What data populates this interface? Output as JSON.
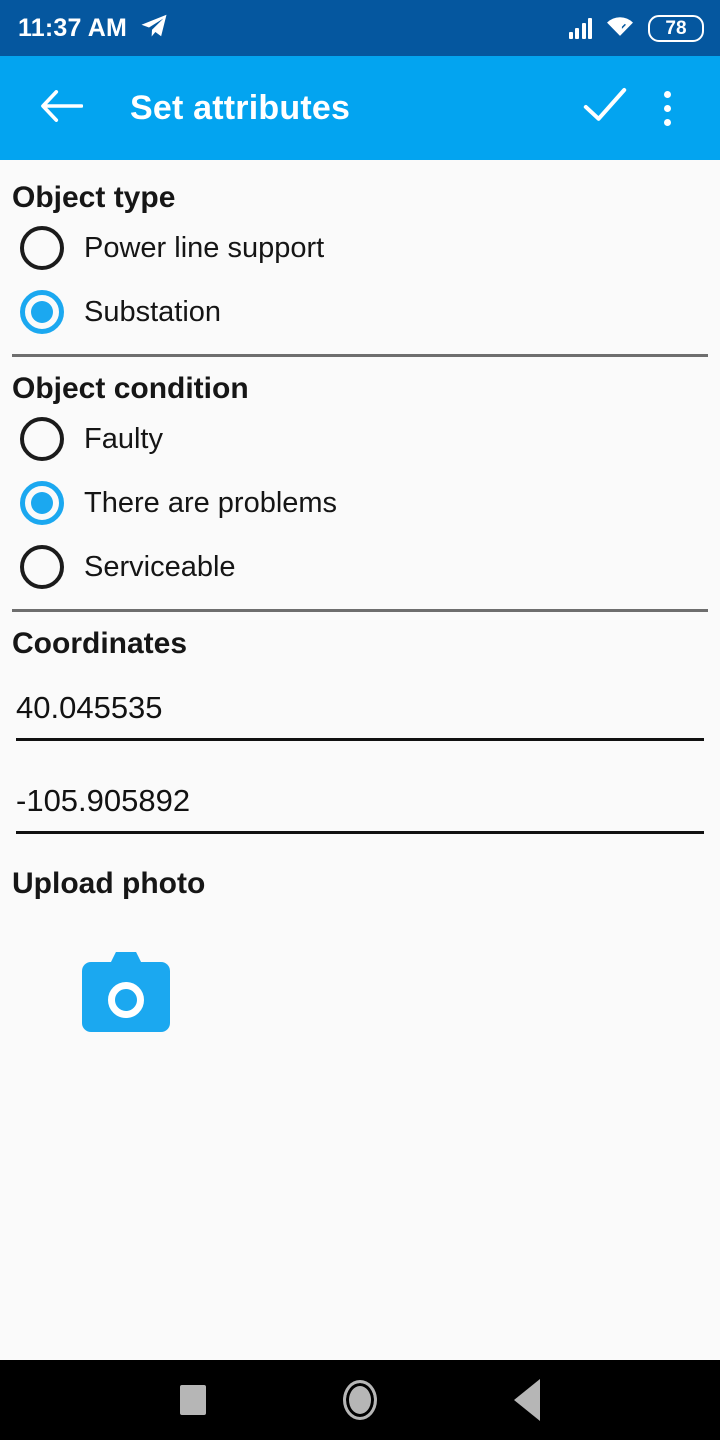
{
  "status_bar": {
    "time": "11:37 AM",
    "notification_icon": "telegram-icon",
    "signal_icon": "signal-bars-icon",
    "wifi_icon": "wifi-icon",
    "battery_level": "78",
    "background_color": "#05579F"
  },
  "app_bar": {
    "title": "Set attributes",
    "back_icon": "back-arrow-icon",
    "confirm_icon": "check-icon",
    "overflow_icon": "more-vertical-icon",
    "background_color": "#03A4F0"
  },
  "sections": {
    "object_type": {
      "title": "Object type",
      "options": [
        {
          "label": "Power line support",
          "selected": false
        },
        {
          "label": "Substation",
          "selected": true
        }
      ]
    },
    "object_condition": {
      "title": "Object condition",
      "options": [
        {
          "label": "Faulty",
          "selected": false
        },
        {
          "label": "There are problems",
          "selected": true
        },
        {
          "label": "Serviceable",
          "selected": false
        }
      ]
    },
    "coordinates": {
      "title": "Coordinates",
      "latitude": "40.045535",
      "longitude": "-105.905892"
    },
    "upload_photo": {
      "title": "Upload photo",
      "camera_icon": "camera-icon"
    }
  },
  "nav_bar": {
    "recents_icon": "square-recents-icon",
    "home_icon": "circle-home-icon",
    "back_icon": "triangle-back-icon",
    "background_color": "#000000"
  },
  "accent_color": "#1BA8F0"
}
